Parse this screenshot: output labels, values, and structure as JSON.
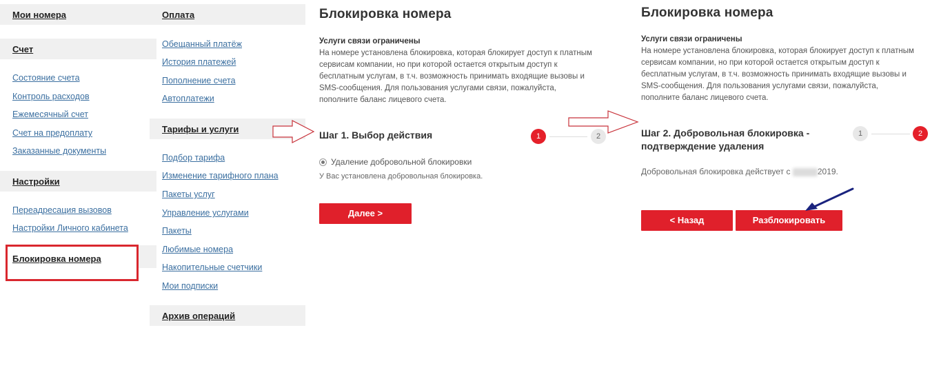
{
  "nav": {
    "my_numbers": "Мои номера",
    "account": {
      "title": "Счет",
      "items": [
        "Состояние счета",
        "Контроль расходов",
        "Ежемесячный счет",
        "Счет на предоплату",
        "Заказанные документы"
      ]
    },
    "settings": {
      "title": "Настройки",
      "items": [
        "Переадресация вызовов",
        "Настройки Личного кабинета"
      ]
    },
    "number_block": "Блокировка номера"
  },
  "col2": {
    "payment": {
      "title": "Оплата",
      "items": [
        "Обещанный платёж",
        "История платежей",
        "Пополнение счета",
        "Автоплатежи"
      ]
    },
    "tariffs": {
      "title": "Тарифы и услуги",
      "items": [
        "Подбор тарифа",
        "Изменение тарифного плана",
        "Пакеты услуг",
        "Управление услугами",
        "Пакеты",
        "Любимые номера",
        "Накопительные счетчики",
        "Мои подписки"
      ]
    },
    "archive": "Архив операций"
  },
  "panel1": {
    "title": "Блокировка номера",
    "restrict_title": "Услуги связи ограничены",
    "restrict_lines": [
      "На номере установлена блокировка, которая блокирует доступ к платным",
      "сервисам компании, но при которой остается открытым доступ к",
      "бесплатным услугам, в т.ч. возможность принимать входящие вызовы и",
      "SMS-сообщения. Для пользования услугами связи, пожалуйста,",
      "пополните баланс лицевого счета."
    ],
    "step_title": "Шаг 1. Выбор действия",
    "step_dots": [
      "1",
      "2"
    ],
    "radio_label": "Удаление добровольной блокировки",
    "note": "У Вас установлена добровольная блокировка.",
    "next_button": "Далее >"
  },
  "panel2": {
    "title": "Блокировка номера",
    "restrict_title": "Услуги связи ограничены",
    "restrict_lines": [
      "На номере установлена блокировка, которая блокирует доступ к платным",
      "сервисам компании, но при которой остается открытым доступ к",
      "бесплатным услугам, в т.ч. возможность принимать входящие вызовы и",
      "SMS-сообщения. Для пользования услугами связи, пожалуйста,",
      "пополните баланс лицевого счета."
    ],
    "step_title_line1": "Шаг 2. Добровольная блокировка -",
    "step_title_line2": "подтверждение удаления",
    "step_dots": [
      "1",
      "2"
    ],
    "status_prefix": "Добровольная блокировка действует с",
    "status_suffix": "2019.",
    "back_button": "< Назад",
    "unblock_button": "Разблокировать"
  },
  "colors": {
    "accent_red": "#e0202b",
    "link_blue": "#3b6fa0",
    "highlight_box": "#d9272e",
    "arrow_navy": "#1a237e"
  },
  "icons": [
    "arrow-right-outline-icon",
    "arrow-pointer-navy-icon"
  ]
}
